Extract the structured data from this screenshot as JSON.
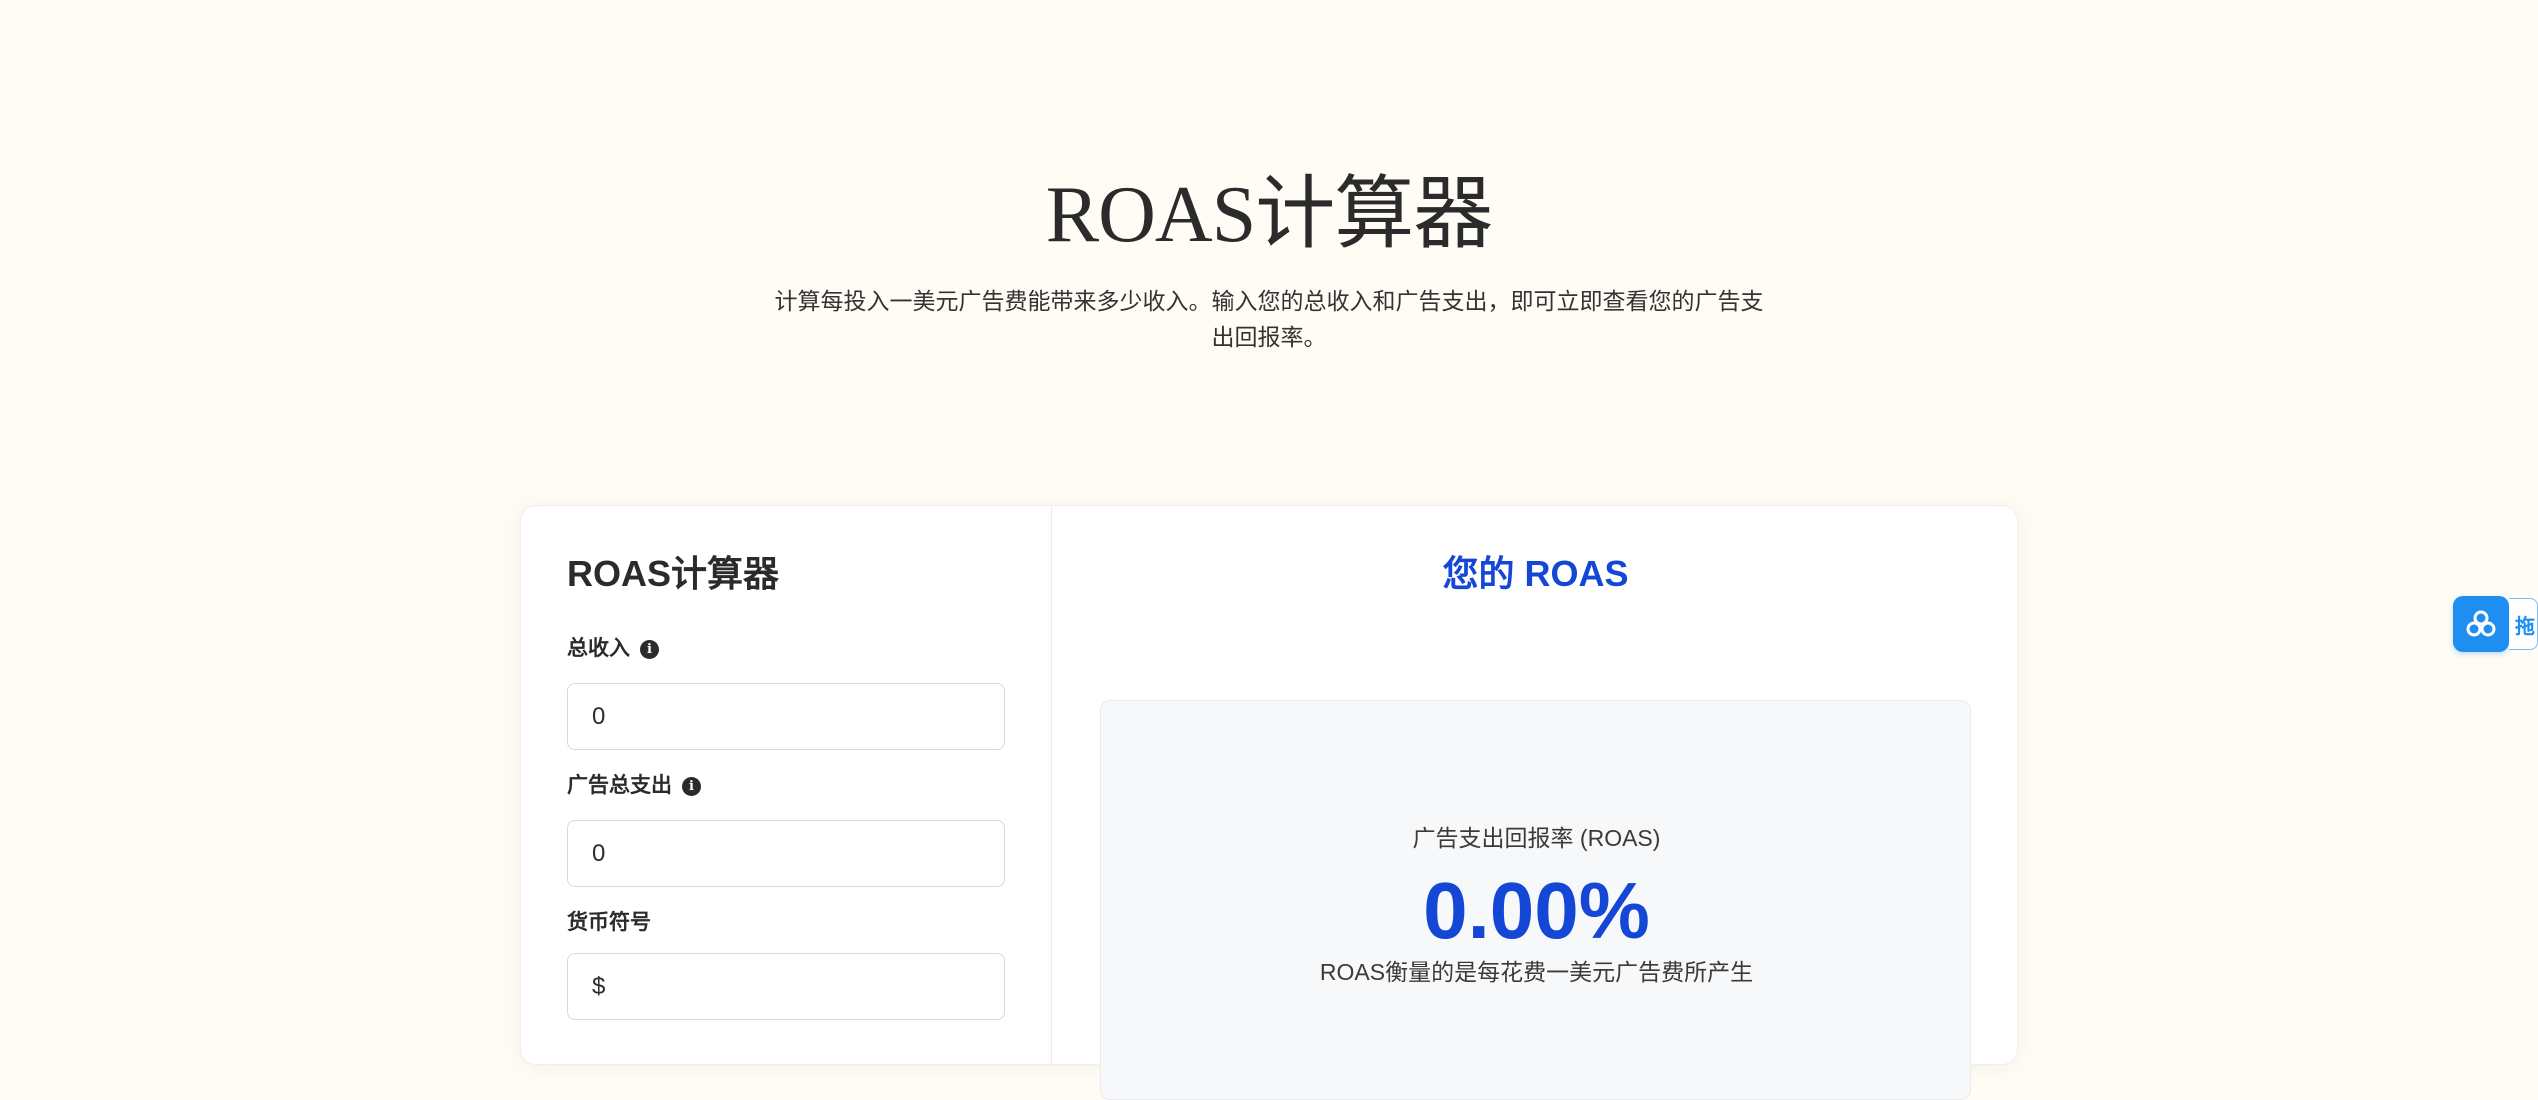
{
  "hero": {
    "title": "ROAS计算器",
    "description": "计算每投入一美元广告费能带来多少收入。输入您的总收入和广告支出，即可立即查看您的广告支出回报率。"
  },
  "calculator": {
    "panel_title": "ROAS计算器",
    "fields": [
      {
        "label": "总收入",
        "value": "0",
        "has_info": true
      },
      {
        "label": "广告总支出",
        "value": "0",
        "has_info": true
      },
      {
        "label": "货币符号",
        "value": "$",
        "has_info": false
      }
    ]
  },
  "result": {
    "title": "您的 ROAS",
    "label": "广告支出回报率 (ROAS)",
    "value": "0.00%",
    "note": "ROAS衡量的是每花费一美元广告费所产生"
  },
  "float_widget": {
    "text": "拖"
  },
  "colors": {
    "background": "#fffcf5",
    "accent": "#1547d6",
    "widget": "#1e8ff0"
  }
}
